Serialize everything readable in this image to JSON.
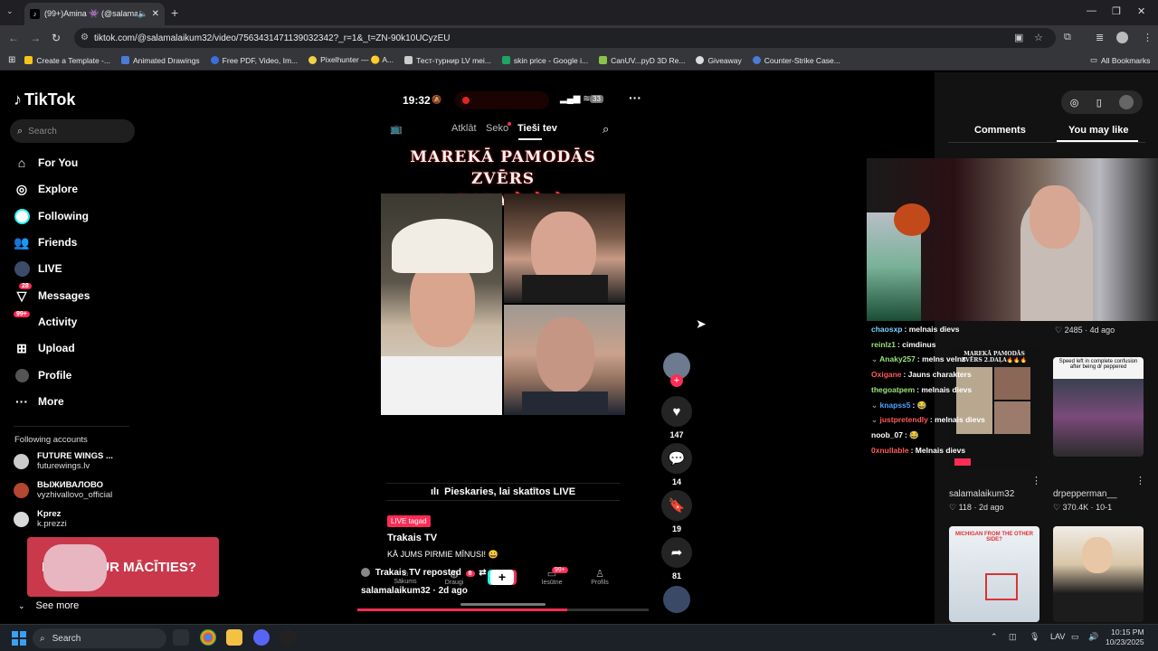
{
  "browser": {
    "tab_title": "(99+)Amina 👾 (@salamalaikum32)",
    "url": "tiktok.com/@salamalaikum32/video/7563431471139032342?_r=1&_t=ZN-90k10UCyzEU",
    "bookmarks": [
      "Create a Template -...",
      "Animated Drawings",
      "Free PDF, Video, Im...",
      "Pixelhunter — 🟡 A...",
      "Тест-турнир LV mei...",
      "skin price - Google i...",
      "CanUV...pyD 3D Re...",
      "Giveaway",
      "Counter-Strike Case..."
    ],
    "all_bookmarks": "All Bookmarks"
  },
  "sidebar": {
    "logo": "TikTok",
    "search_placeholder": "Search",
    "nav": [
      {
        "label": "For You",
        "icon": "home-icon"
      },
      {
        "label": "Explore",
        "icon": "compass-icon"
      },
      {
        "label": "Following",
        "icon": "following-icon"
      },
      {
        "label": "Friends",
        "icon": "friends-icon"
      },
      {
        "label": "LIVE",
        "icon": "live-icon"
      },
      {
        "label": "Messages",
        "icon": "messages-icon",
        "badge": "28"
      },
      {
        "label": "Activity",
        "icon": "activity-icon",
        "badge": "99+"
      },
      {
        "label": "Upload",
        "icon": "upload-icon"
      },
      {
        "label": "Profile",
        "icon": "profile-icon"
      },
      {
        "label": "More",
        "icon": "more-icon"
      }
    ],
    "following_header": "Following accounts",
    "following": [
      {
        "name": "FUTURE WINGS ...",
        "handle": "futurewings.lv"
      },
      {
        "name": "ВЫЖИВАЛОВО",
        "handle": "vyzhivallovo_official"
      },
      {
        "name": "Kprez",
        "handle": "k.prezzi"
      }
    ],
    "ad_text": "NEZINI KUR MĀCĪTIES?",
    "see_more": "See more"
  },
  "video": {
    "time": "19:32",
    "battery": "33",
    "tabs": [
      "Atklāt",
      "Seko",
      "Tieši tev"
    ],
    "title_line1": "MAREKĀ PAMODĀS ZVĒRS",
    "title_line2": "2.DAĻA🔥🔥🔥",
    "watch_live": "Pieskaries, lai skatītos LIVE",
    "live_tag": "LIVE tagad",
    "live_name": "Trakais TV",
    "live_caption": "KĀ JUMS PIRMIE MĪNUSI! 😀",
    "bottom_nav": [
      "Sākums",
      "Draugi",
      "Iesūtne",
      "Profils"
    ],
    "inbox_badge": "99+",
    "friends_badge": "8",
    "repost_text": "Trakais TV reposted",
    "author_line": "salamalaikum32 · 2d ago",
    "progress": 0.72
  },
  "actions": {
    "likes": "147",
    "comments": "14",
    "saves": "19",
    "shares": "81"
  },
  "right_panel": {
    "tabs": [
      "Comments",
      "You may like"
    ],
    "chat": [
      {
        "user": "chaosxp",
        "msg": "melnais dievs",
        "color": "#7fd4ff"
      },
      {
        "user": "reinIz1",
        "msg": "cimdinus",
        "color": "#9be37d"
      },
      {
        "user": "Anaky257",
        "msg": "melns velns",
        "color": "#9be37d"
      },
      {
        "user": "Oxigane",
        "msg": "Jauns charakters",
        "color": "#ff5a5a"
      },
      {
        "user": "thegoatpem",
        "msg": "melnais dievs",
        "color": "#9be37d"
      },
      {
        "user": "knapss5",
        "msg": "😂",
        "color": "#4fa3ff"
      },
      {
        "user": "justpretendly",
        "msg": "melnais dievs",
        "color": "#ff5a5a"
      },
      {
        "user": "noob_07",
        "msg": "😂",
        "color": "#ffffff"
      },
      {
        "user": "0xnullable",
        "msg": "Melnais dievs",
        "color": "#ff5a5a"
      }
    ],
    "cards": [
      {
        "likes": "2485",
        "age": "4d ago"
      },
      {
        "caption": "salamalaikum32",
        "likes": "118",
        "age": "2d ago"
      },
      {
        "caption": "drpepperman__",
        "likes": "370.4K",
        "age": "10-1"
      }
    ],
    "thumb2_text": "Speed left in complete confusion after being dr peppered",
    "thumb3_text": "MICHIGAN FROM THE OTHER SIDE?",
    "mini_title": "MAREKĀ PAMODĀS ZVĒRS 2.DAĻA🔥🔥🔥"
  },
  "taskbar": {
    "search": "Search",
    "lang": "LAV",
    "time": "10:15 PM",
    "date": "10/23/2025"
  },
  "colors": {
    "accent": "#fe2c55",
    "cyan": "#25f4ee"
  }
}
